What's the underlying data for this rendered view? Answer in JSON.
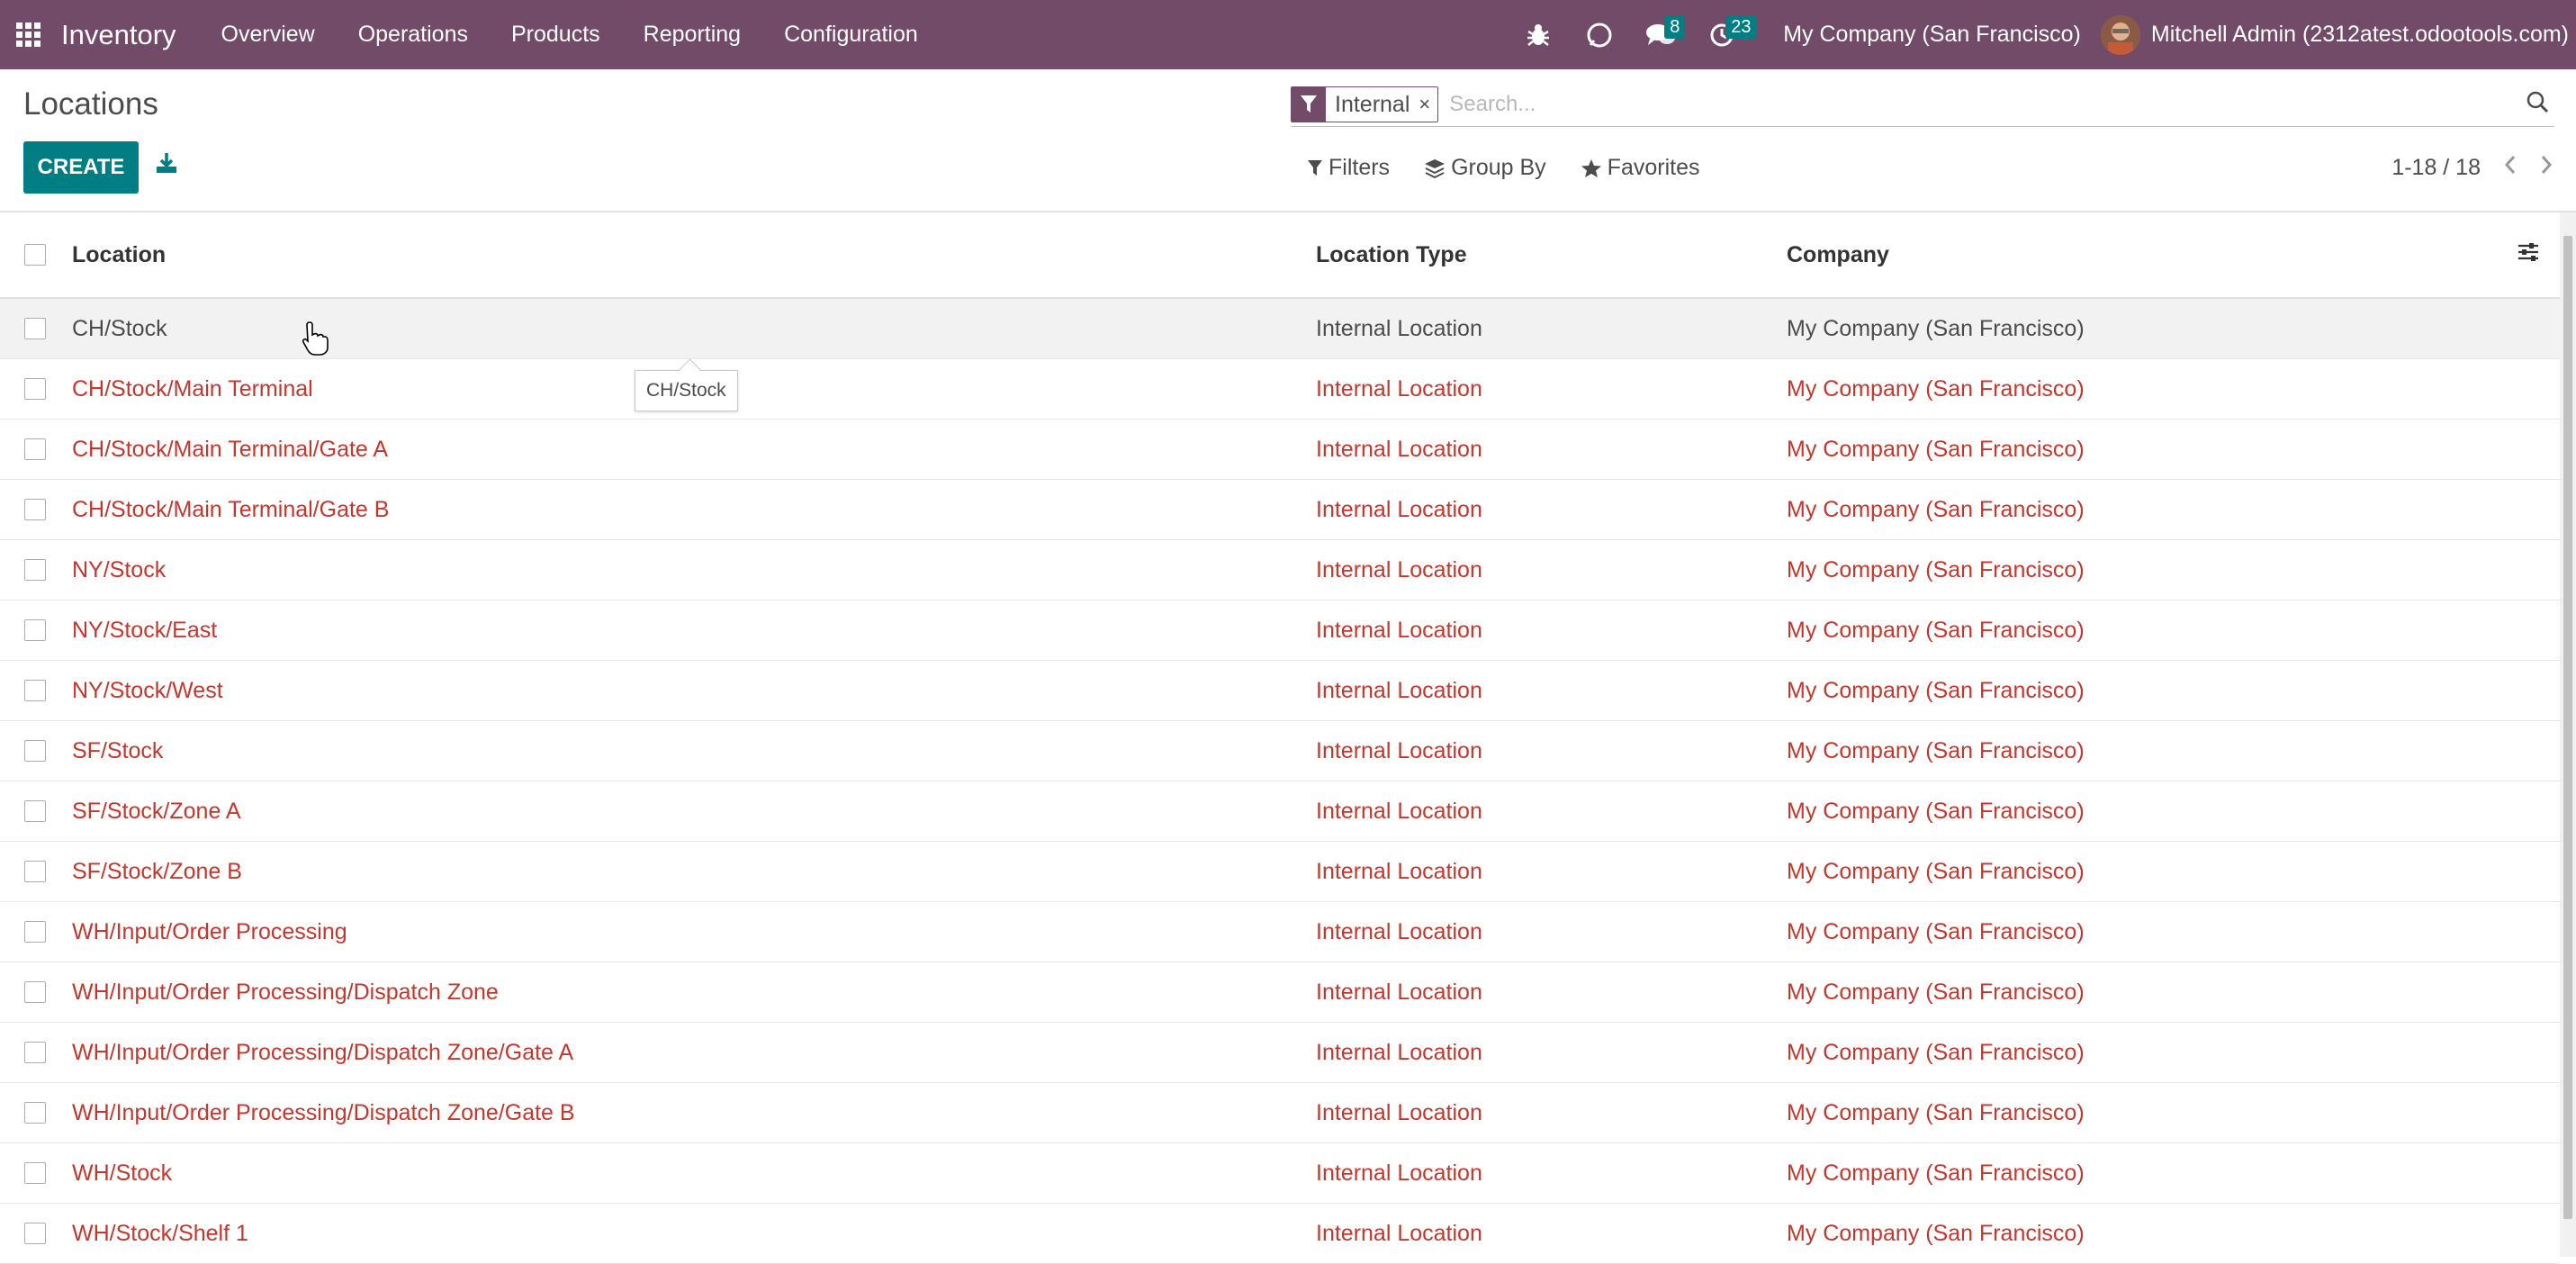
{
  "navbar": {
    "app_name": "Inventory",
    "menu": [
      "Overview",
      "Operations",
      "Products",
      "Reporting",
      "Configuration"
    ],
    "messages_count": "8",
    "activities_count": "23",
    "company": "My Company (San Francisco)",
    "user": "Mitchell Admin (2312atest.odootools.com)"
  },
  "control_panel": {
    "title": "Locations",
    "create_label": "CREATE",
    "search": {
      "facet_value": "Internal",
      "placeholder": "Search..."
    },
    "filters_label": "Filters",
    "group_by_label": "Group By",
    "favorites_label": "Favorites",
    "pager": "1-18 / 18"
  },
  "table": {
    "headers": [
      "Location",
      "Location Type",
      "Company"
    ],
    "rows": [
      {
        "location": "CH/Stock",
        "type": "Internal Location",
        "company": "My Company (San Francisco)"
      },
      {
        "location": "CH/Stock/Main Terminal",
        "type": "Internal Location",
        "company": "My Company (San Francisco)"
      },
      {
        "location": "CH/Stock/Main Terminal/Gate A",
        "type": "Internal Location",
        "company": "My Company (San Francisco)"
      },
      {
        "location": "CH/Stock/Main Terminal/Gate B",
        "type": "Internal Location",
        "company": "My Company (San Francisco)"
      },
      {
        "location": "NY/Stock",
        "type": "Internal Location",
        "company": "My Company (San Francisco)"
      },
      {
        "location": "NY/Stock/East",
        "type": "Internal Location",
        "company": "My Company (San Francisco)"
      },
      {
        "location": "NY/Stock/West",
        "type": "Internal Location",
        "company": "My Company (San Francisco)"
      },
      {
        "location": "SF/Stock",
        "type": "Internal Location",
        "company": "My Company (San Francisco)"
      },
      {
        "location": "SF/Stock/Zone A",
        "type": "Internal Location",
        "company": "My Company (San Francisco)"
      },
      {
        "location": "SF/Stock/Zone B",
        "type": "Internal Location",
        "company": "My Company (San Francisco)"
      },
      {
        "location": "WH/Input/Order Processing",
        "type": "Internal Location",
        "company": "My Company (San Francisco)"
      },
      {
        "location": "WH/Input/Order Processing/Dispatch Zone",
        "type": "Internal Location",
        "company": "My Company (San Francisco)"
      },
      {
        "location": "WH/Input/Order Processing/Dispatch Zone/Gate A",
        "type": "Internal Location",
        "company": "My Company (San Francisco)"
      },
      {
        "location": "WH/Input/Order Processing/Dispatch Zone/Gate B",
        "type": "Internal Location",
        "company": "My Company (San Francisco)"
      },
      {
        "location": "WH/Stock",
        "type": "Internal Location",
        "company": "My Company (San Francisco)"
      },
      {
        "location": "WH/Stock/Shelf 1",
        "type": "Internal Location",
        "company": "My Company (San Francisco)"
      }
    ]
  },
  "tooltip": "CH/Stock",
  "colors": {
    "navbar": "#714b67",
    "primary_button": "#017e84",
    "archived_text": "#c5362c"
  },
  "icons": [
    "apps-grid-icon",
    "bug-icon",
    "discuss-icon",
    "chat-icon",
    "clock-icon",
    "download-icon",
    "filter-icon",
    "layers-icon",
    "star-icon",
    "search-icon",
    "chevron-left-icon",
    "chevron-right-icon",
    "optional-columns-icon"
  ]
}
